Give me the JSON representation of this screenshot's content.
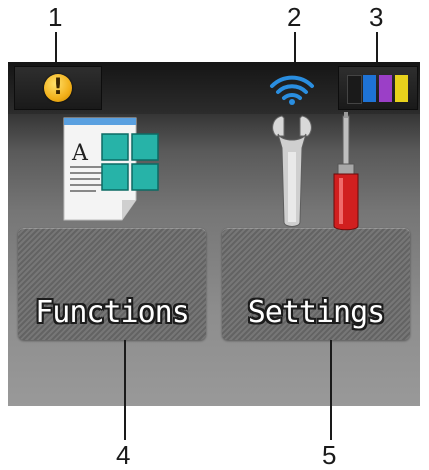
{
  "callouts": [
    "1",
    "2",
    "3",
    "4",
    "5"
  ],
  "status_bar": {
    "alert_icon": "warning-exclamation-icon",
    "alert_glyph": "!",
    "wifi_icon": "wifi-signal-icon",
    "ink_icon": "ink-level-icon",
    "ink_colors": [
      "#1a1a1a",
      "#1e73d6",
      "#9b3fc7",
      "#e8d21c"
    ]
  },
  "tiles": {
    "functions": {
      "label": "Functions",
      "icon": "document-grid-icon"
    },
    "settings": {
      "label": "Settings",
      "icon": "wrench-screwdriver-icon"
    }
  },
  "colors": {
    "wifi": "#2a8ee0",
    "alert": "#f2b01a",
    "screwdriver": "#d11f1f"
  }
}
